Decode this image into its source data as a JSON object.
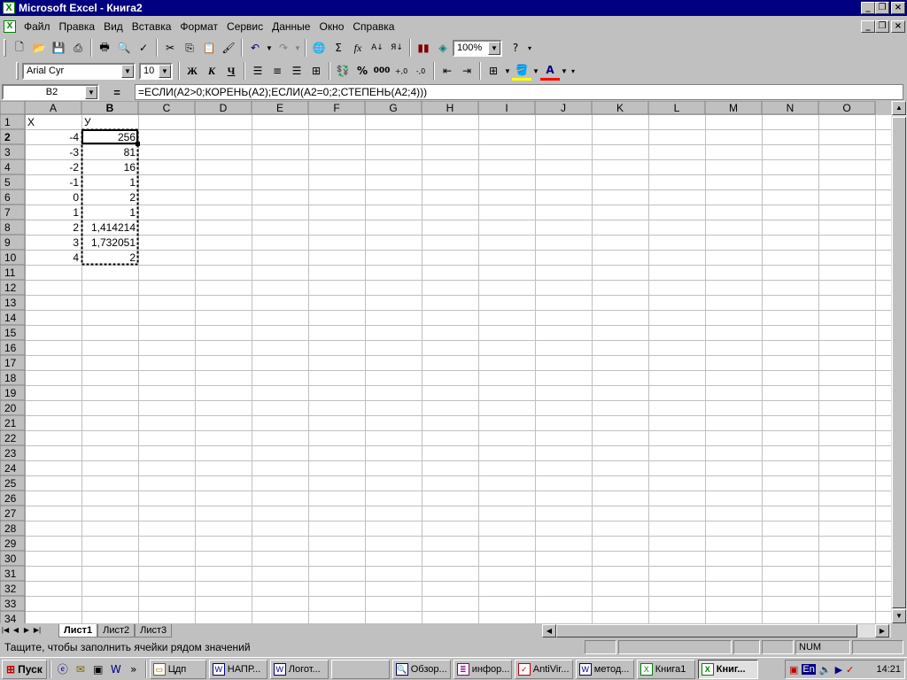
{
  "title": "Microsoft Excel - Книга2",
  "menu": [
    "Файл",
    "Правка",
    "Вид",
    "Вставка",
    "Формат",
    "Сервис",
    "Данные",
    "Окно",
    "Справка"
  ],
  "toolbar": {
    "zoom": "100%",
    "font": "Arial Cyr",
    "size": "10",
    "bold": "Ж",
    "italic": "К",
    "underline": "Ч"
  },
  "formula_bar": {
    "name_box": "B2",
    "formula": "=ЕСЛИ(A2>0;КОРЕНЬ(A2);ЕСЛИ(A2=0;2;СТЕПЕНЬ(A2;4)))"
  },
  "columns": [
    "A",
    "B",
    "C",
    "D",
    "E",
    "F",
    "G",
    "H",
    "I",
    "J",
    "K",
    "L",
    "M",
    "N",
    "O"
  ],
  "row_count": 34,
  "selected_cell": "B2",
  "cells": {
    "A1": "X",
    "B1": "У",
    "A2": "-4",
    "B2": "256",
    "A3": "-3",
    "B3": "81",
    "A4": "-2",
    "B4": "16",
    "A5": "-1",
    "B5": "1",
    "A6": "0",
    "B6": "2",
    "A7": "1",
    "B7": "1",
    "A8": "2",
    "B8": "1,414214",
    "A9": "3",
    "B9": "1,732051",
    "A10": "4",
    "B10": "2"
  },
  "sheets": [
    "Лист1",
    "Лист2",
    "Лист3"
  ],
  "active_sheet": "Лист1",
  "status": {
    "message": "Тащите, чтобы заполнить ячейки рядом значений",
    "num": "NUM"
  },
  "taskbar": {
    "start": "Пуск",
    "buttons": [
      "Цдп",
      "НАПР...",
      "Логот...",
      "",
      "Обзор...",
      "инфор...",
      "AntiVir...",
      "метод...",
      "Книга1",
      "Книг..."
    ],
    "active_index": 9,
    "lang": "En",
    "clock": "14:21"
  },
  "colors": {
    "title": "#000080",
    "face": "#c0c0c0"
  }
}
